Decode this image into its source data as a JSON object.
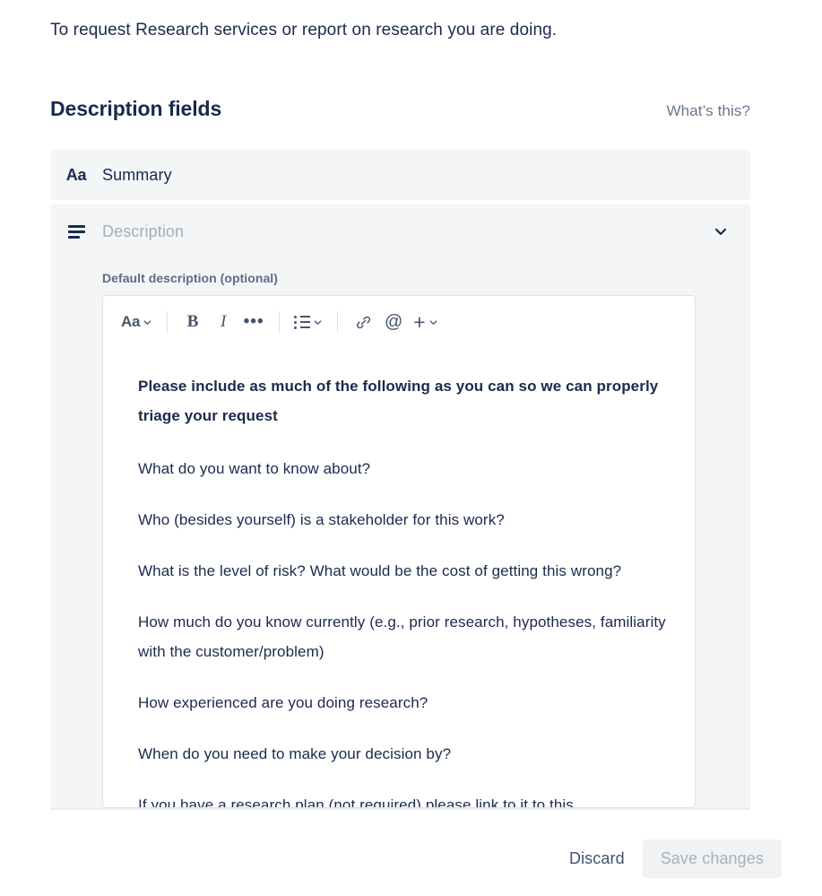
{
  "intro": {
    "text": "To request Research services or report on research you are doing."
  },
  "section": {
    "title": "Description fields",
    "help_link": "What’s this?"
  },
  "fields": [
    {
      "icon": "text-format-icon",
      "icon_glyph": "Aa",
      "label": "Summary",
      "expanded": false
    },
    {
      "icon": "paragraph-lines-icon",
      "label": "Description",
      "expanded": true,
      "sublabel": "Default description (optional)",
      "chevron": "chevron-down-icon"
    }
  ],
  "editor": {
    "toolbar": [
      {
        "name": "text-style-button",
        "glyph": "Aa",
        "has_chevron": true
      },
      {
        "name": "bold-button",
        "glyph": "B",
        "has_chevron": false
      },
      {
        "name": "italic-button",
        "glyph": "I",
        "has_chevron": false
      },
      {
        "name": "more-formatting-button",
        "glyph": "•••",
        "has_chevron": false
      },
      {
        "name": "bullet-list-button",
        "glyph": "list",
        "has_chevron": true
      },
      {
        "name": "link-button",
        "glyph": "link",
        "has_chevron": false
      },
      {
        "name": "mention-button",
        "glyph": "@",
        "has_chevron": false
      },
      {
        "name": "insert-button",
        "glyph": "+",
        "has_chevron": true
      }
    ],
    "paragraphs": [
      {
        "text": "Please include as much of the following as you can so we can properly triage your request",
        "bold": true
      },
      {
        "text": "What do you want to know about?",
        "bold": false
      },
      {
        "text": "Who (besides yourself) is a stakeholder for this work?",
        "bold": false
      },
      {
        "text": "What is the level of risk? What would be the cost of getting this wrong?",
        "bold": false
      },
      {
        "text": "How much do you know currently (e.g., prior research, hypotheses, familiarity with the customer/problem)",
        "bold": false
      },
      {
        "text": "How experienced are you doing research?",
        "bold": false
      },
      {
        "text": "When do you need to make your decision by?",
        "bold": false
      },
      {
        "text": "If you have a research plan (not required) please link to it to this",
        "bold": false
      }
    ]
  },
  "footer": {
    "discard_label": "Discard",
    "save_label": "Save changes",
    "save_disabled": true
  },
  "colors": {
    "text_primary": "#172B4D",
    "text_body": "#1B2A4E",
    "text_muted": "#6B778C",
    "placeholder": "#A5ADBA",
    "panel_bg": "#F4F5F7",
    "editor_border": "#DFE1E6",
    "save_disabled_bg": "#F1F2F4",
    "save_disabled_text": "#A9AFBC"
  }
}
